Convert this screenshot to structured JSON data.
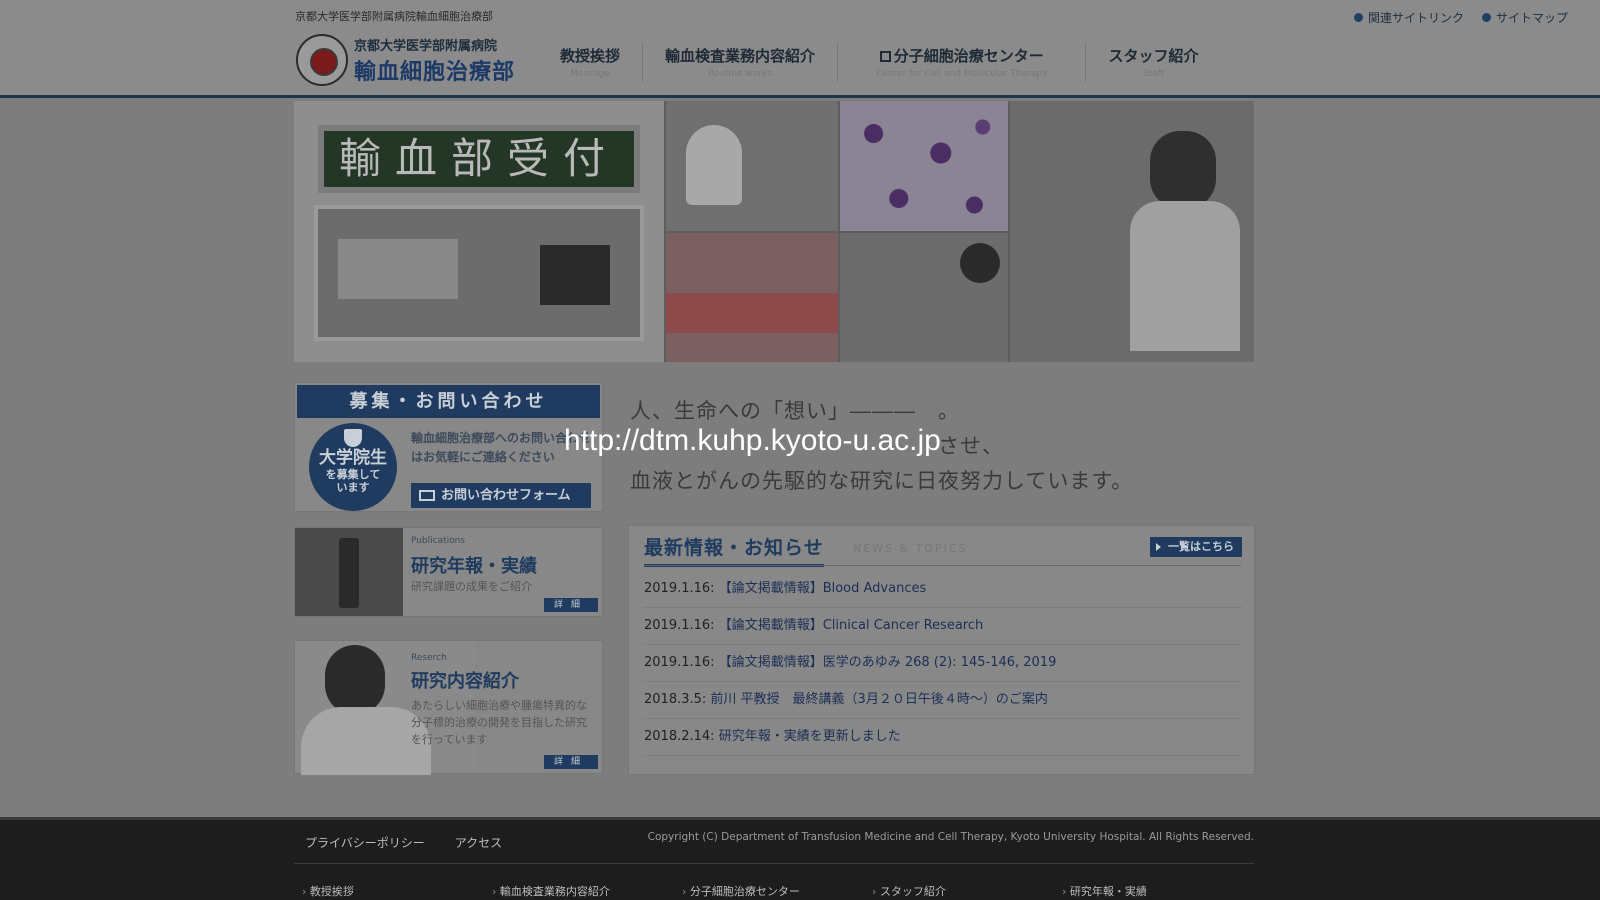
{
  "header": {
    "tagline": "京都大学医学部附属病院輸血細胞治療部",
    "util_links": [
      "関連サイトリンク",
      "サイトマップ"
    ],
    "logo_line1": "京都大学医学部附属病院",
    "logo_line2": "輸血細胞治療部",
    "nav": [
      {
        "ja": "教授挨拶",
        "en": "Message"
      },
      {
        "ja": "輸血検査業務内容紹介",
        "en": "Routine works"
      },
      {
        "ja": "分子細胞治療センター",
        "en": "Center for Cell and Molecular Therapy"
      },
      {
        "ja": "スタッフ紹介",
        "en": "Staff"
      }
    ]
  },
  "hero": {
    "sign_text": "輸血部受付"
  },
  "recruit": {
    "heading": "募集・お問い合わせ",
    "badge_line1": "大学院生",
    "badge_line2": "を募集して",
    "badge_line3": "います",
    "text": "輸血細胞治療部へのお問い合わせはお気軽にご連絡ください",
    "button": "お問い合わせフォーム"
  },
  "cards": {
    "publications": {
      "category": "Publications",
      "title": "研究年報・実績",
      "desc": "研究課題の成果をご紹介",
      "button": "詳細"
    },
    "research": {
      "category": "Reserch",
      "title": "研究内容紹介",
      "desc": "あたらしい細胞治療や腫瘍特異的な分子標的治療の開発を目指した研究を行っています",
      "button": "詳細"
    }
  },
  "main": {
    "tagline_line1": "人、生命への「想い」―――　。",
    "tagline_line2": "　　　　　　　　　　　　　　させ、",
    "tagline_line3": "血液とがんの先駆的な研究に日夜努力しています。",
    "url_overlay": "http://dtm.kuhp.kyoto-u.ac.jp"
  },
  "news": {
    "title": "最新情報・お知らせ",
    "subtitle": "NEWS & TOPICS",
    "view_all": "一覧はこちら",
    "items": [
      {
        "date": "2019.1.16:",
        "text": "【論文掲載情報】Blood Advances"
      },
      {
        "date": "2019.1.16:",
        "text": "【論文掲載情報】Clinical Cancer Research"
      },
      {
        "date": "2019.1.16:",
        "text": "【論文掲載情報】医学のあゆみ 268 (2): 145-146, 2019"
      },
      {
        "date": "2018.3.5:",
        "text": "前川 平教授　最終講義（3月２０日午後４時〜）のご案内"
      },
      {
        "date": "2018.2.14:",
        "text": "研究年報・実績を更新しました"
      }
    ]
  },
  "footer": {
    "links": [
      "プライバシーポリシー",
      "アクセス"
    ],
    "copyright": "Copyright (C) Department of Transfusion Medicine and Cell Therapy, Kyoto University Hospital. All Rights Reserved.",
    "nav": [
      "教授挨拶",
      "輸血検査業務内容紹介",
      "分子細胞治療センター",
      "スタッフ紹介",
      "研究年報・実績"
    ]
  }
}
